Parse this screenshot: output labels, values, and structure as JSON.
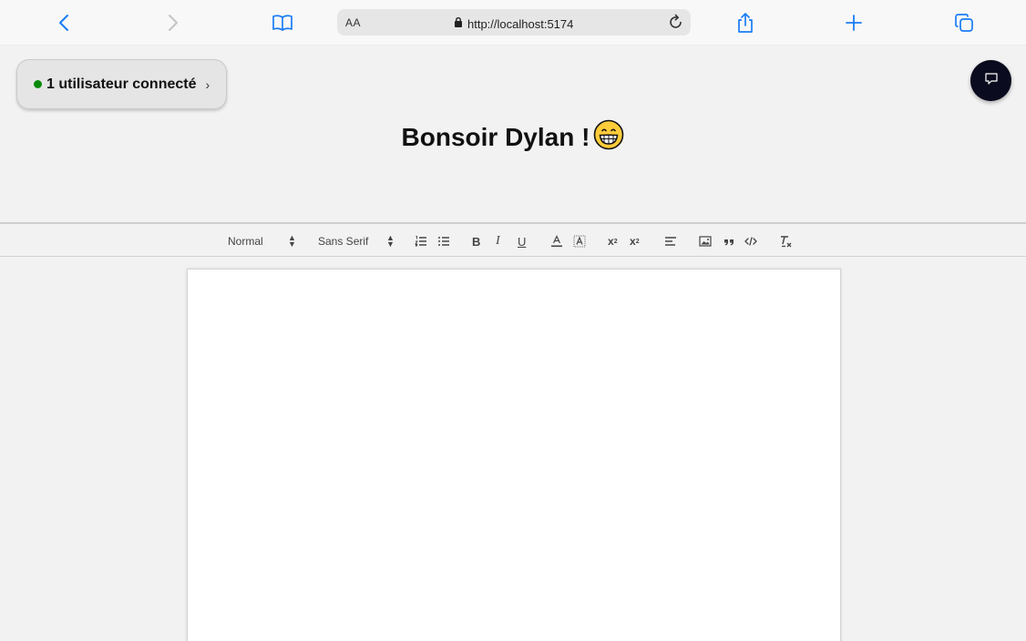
{
  "browser": {
    "reader_label": "AA",
    "url": "http://localhost:5174",
    "icons": [
      "back-icon",
      "forward-icon",
      "bookmarks-icon",
      "lock-icon",
      "reload-icon",
      "share-icon",
      "new-tab-icon",
      "tabs-icon"
    ],
    "accent_color": "#1a7cf5"
  },
  "presence": {
    "label": "1 utilisateur connecté",
    "chevron": "›",
    "status_color": "#0a8a0a"
  },
  "greeting": {
    "text": "Bonsoir Dylan !",
    "emoji": "grinning-face"
  },
  "editor_toolbar": {
    "header_select": "Normal",
    "font_select": "Sans Serif",
    "buttons": [
      "ordered-list",
      "bullet-list",
      "bold",
      "italic",
      "underline",
      "text-color",
      "background-color",
      "subscript",
      "superscript",
      "align",
      "image",
      "blockquote",
      "code-block",
      "clean"
    ]
  },
  "document": {
    "content": ""
  }
}
